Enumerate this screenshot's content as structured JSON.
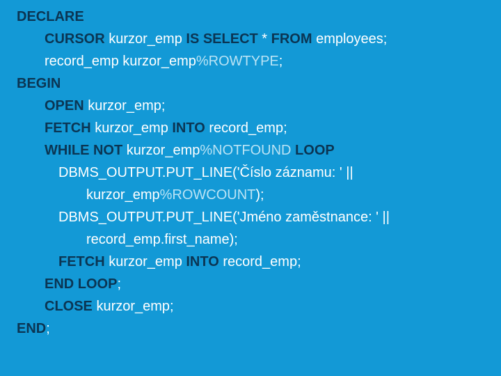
{
  "code": {
    "lines": [
      {
        "indent": 0,
        "tokens": [
          {
            "t": "DECLARE",
            "c": "kw"
          }
        ]
      },
      {
        "indent": 1,
        "tokens": [
          {
            "t": "CURSOR ",
            "c": "kw"
          },
          {
            "t": "kurzor_emp ",
            "c": "txt"
          },
          {
            "t": "IS SELECT ",
            "c": "kw"
          },
          {
            "t": "* ",
            "c": "txt"
          },
          {
            "t": "FROM ",
            "c": "kw"
          },
          {
            "t": "employees;",
            "c": "txt"
          }
        ]
      },
      {
        "indent": 1,
        "tokens": [
          {
            "t": "record_emp kurzor_emp",
            "c": "txt"
          },
          {
            "t": "%ROWTYPE",
            "c": "pale"
          },
          {
            "t": ";",
            "c": "txt"
          }
        ]
      },
      {
        "indent": 0,
        "tokens": [
          {
            "t": "BEGIN",
            "c": "kw"
          }
        ]
      },
      {
        "indent": 1,
        "tokens": [
          {
            "t": "OPEN ",
            "c": "kw"
          },
          {
            "t": "kurzor_emp;",
            "c": "txt"
          }
        ]
      },
      {
        "indent": 1,
        "tokens": [
          {
            "t": "FETCH ",
            "c": "kw"
          },
          {
            "t": "kurzor_emp ",
            "c": "txt"
          },
          {
            "t": "INTO ",
            "c": "kw"
          },
          {
            "t": "record_emp;",
            "c": "txt"
          }
        ]
      },
      {
        "indent": 1,
        "tokens": [
          {
            "t": "WHILE NOT ",
            "c": "kw"
          },
          {
            "t": "kurzor_emp",
            "c": "txt"
          },
          {
            "t": "%NOTFOUND ",
            "c": "pale"
          },
          {
            "t": "LOOP",
            "c": "kw"
          }
        ]
      },
      {
        "indent": 2,
        "tokens": [
          {
            "t": "DBMS_OUTPUT.PUT_LINE('Číslo záznamu: ' ||",
            "c": "txt"
          }
        ]
      },
      {
        "indent": 3,
        "tokens": [
          {
            "t": "kurzor_emp",
            "c": "txt"
          },
          {
            "t": "%ROWCOUNT",
            "c": "pale"
          },
          {
            "t": ");",
            "c": "txt"
          }
        ]
      },
      {
        "indent": 2,
        "tokens": [
          {
            "t": "DBMS_OUTPUT.PUT_LINE('Jméno zaměstnance: ' ||",
            "c": "txt"
          }
        ]
      },
      {
        "indent": 3,
        "tokens": [
          {
            "t": "record_emp.first_name);",
            "c": "txt"
          }
        ]
      },
      {
        "indent": 2,
        "tokens": [
          {
            "t": "FETCH ",
            "c": "kw"
          },
          {
            "t": "kurzor_emp ",
            "c": "txt"
          },
          {
            "t": "INTO ",
            "c": "kw"
          },
          {
            "t": "record_emp;",
            "c": "txt"
          }
        ]
      },
      {
        "indent": 1,
        "tokens": [
          {
            "t": "END LOOP",
            "c": "kw"
          },
          {
            "t": ";",
            "c": "txt"
          }
        ]
      },
      {
        "indent": 1,
        "tokens": [
          {
            "t": "CLOSE ",
            "c": "kw"
          },
          {
            "t": "kurzor_emp;",
            "c": "txt"
          }
        ]
      },
      {
        "indent": 0,
        "tokens": [
          {
            "t": "END",
            "c": "kw"
          },
          {
            "t": ";",
            "c": "txt"
          }
        ]
      }
    ]
  }
}
